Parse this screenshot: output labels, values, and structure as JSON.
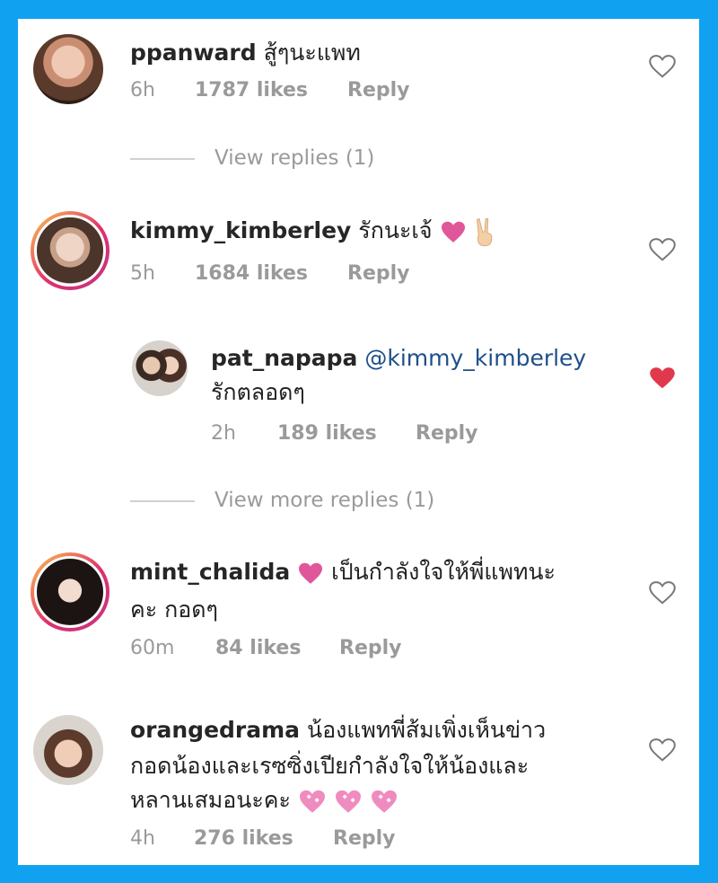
{
  "comments": [
    {
      "username": "ppanward",
      "text": "สู้ๆนะแพท",
      "time": "6h",
      "likes": "1787 likes",
      "reply": "Reply",
      "view_replies": "View replies (1)"
    },
    {
      "username": "kimmy_kimberley",
      "text": "รักนะเจ้",
      "time": "5h",
      "likes": "1684 likes",
      "reply": "Reply",
      "replies": [
        {
          "username": "pat_napapa",
          "mention": "@kimmy_kimberley",
          "text": "รักตลอดๆ",
          "time": "2h",
          "likes": "189 likes",
          "reply": "Reply",
          "liked": true
        }
      ],
      "view_replies": "View more replies (1)"
    },
    {
      "username": "mint_chalida",
      "text_line1": "เป็นกำลังใจให้พี่แพทนะ",
      "text_line2": "คะ กอดๆ",
      "time": "60m",
      "likes": "84 likes",
      "reply": "Reply"
    },
    {
      "username": "orangedrama",
      "text_line1": "น้องแพทพี่ส้มเพิ่งเห็นข่าว",
      "text_line2": "กอดน้องและเรซซิ่งเปียกำลังใจให้น้องและ",
      "text_line3": "หลานเสมอนะคะ",
      "time": "4h",
      "likes": "276 likes",
      "reply": "Reply"
    }
  ],
  "colors": {
    "background": "#10a2f0",
    "liked_heart": "#e0394c",
    "pink_heart": "#e0569a",
    "meta_text": "#9a9a9a"
  },
  "icons": [
    "heart-outline-icon",
    "heart-filled-icon",
    "pink-heart-emoji",
    "victory-hand-emoji",
    "sparkling-heart-emoji"
  ]
}
